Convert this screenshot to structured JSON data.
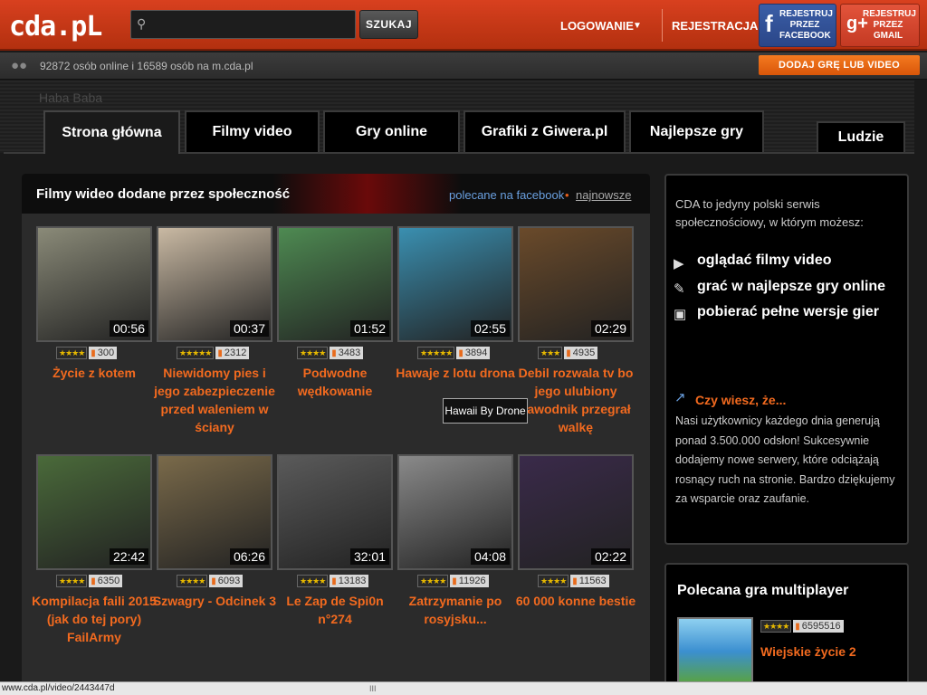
{
  "header": {
    "logo": "cda.pL",
    "search_placeholder": "",
    "search_button": "SZUKAJ",
    "login": "LOGOWANIE",
    "register": "REJESTRACJA",
    "facebook_button": "REJESTRUJ PRZEZ FACEBOOK",
    "gmail_button": "REJESTRUJ PRZEZ GMAIL"
  },
  "infobar": {
    "online_text": "92872 osób online i 16589 osób na m.cda.pl",
    "add_button": "DODAJ GRĘ LUB VIDEO"
  },
  "breadcrumb": "Haba Baba",
  "tabs": [
    {
      "label": "Strona główna",
      "active": true
    },
    {
      "label": "Filmy video"
    },
    {
      "label": "Gry online"
    },
    {
      "label": "Grafiki z Giwera.pl"
    },
    {
      "label": "Najlepsze gry"
    },
    {
      "label": "Ludzie"
    }
  ],
  "videos_panel": {
    "title": "Filmy wideo dodane przez społeczność",
    "link_facebook": "polecane na facebook",
    "separator": "•",
    "link_newest": "najnowsze",
    "videos": [
      {
        "title": "Życie z kotem",
        "duration": "00:56",
        "views": "300",
        "stars": "★★★★",
        "thumb_color": "#8a8a78"
      },
      {
        "title": "Niewidomy pies i jego zabezpieczenie przed waleniem w ściany",
        "duration": "00:37",
        "views": "2312",
        "stars": "★★★★★",
        "thumb_color": "#c9b9a3"
      },
      {
        "title": "Podwodne wędkowanie",
        "duration": "01:52",
        "views": "3483",
        "stars": "★★★★",
        "thumb_color": "#4e8a52"
      },
      {
        "title": "Hawaje z lotu drona",
        "duration": "02:55",
        "views": "3894",
        "stars": "★★★★★",
        "thumb_color": "#3a8fb0"
      },
      {
        "title": "Debil rozwala tv bo jego ulubiony zawodnik przegrał walkę",
        "duration": "02:29",
        "views": "4935",
        "stars": "★★★",
        "thumb_color": "#6a4a2a"
      },
      {
        "title": "Kompilacja faili 2015 (jak do tej pory) FailArmy",
        "duration": "22:42",
        "views": "6350",
        "stars": "★★★★",
        "thumb_color": "#4a6a3a"
      },
      {
        "title": "Szwagry - Odcinek 3",
        "duration": "06:26",
        "views": "6093",
        "stars": "★★★★",
        "thumb_color": "#7a6a4a"
      },
      {
        "title": "Le Zap de Spi0n n°274",
        "duration": "32:01",
        "views": "13183",
        "stars": "★★★★",
        "thumb_color": "#5a5a5a"
      },
      {
        "title": "Zatrzymanie po rosyjsku...",
        "duration": "04:08",
        "views": "11926",
        "stars": "★★★★",
        "thumb_color": "#8a8a8a"
      },
      {
        "title": "60 000 konne bestie",
        "duration": "02:22",
        "views": "11563",
        "stars": "★★★★",
        "thumb_color": "#3a2a4a"
      }
    ],
    "tooltip": "Hawaii By Drone"
  },
  "info_panel": {
    "intro": "CDA to jedyny polski serwis społecznościowy, w którym możesz:",
    "features": [
      "oglądać filmy video",
      "grać w najlepsze gry online",
      "pobierać pełne wersje gier"
    ],
    "did_you_know_title": "Czy wiesz, że...",
    "did_you_know_text": "Nasi użytkownicy każdego dnia generują ponad 3.500.000 odsłon! Sukcesywnie dodajemy nowe serwery, które odciążają rosnący ruch na stronie. Bardzo dziękujemy za wsparcie oraz zaufanie."
  },
  "recommended": {
    "title": "Polecana gra multiplayer",
    "game_name": "Wiejskie życie 2",
    "game_views": "6595516",
    "game_stars": "★★★★"
  },
  "statusbar": {
    "url": "www.cda.pl/video/2443447d",
    "grip": "III"
  }
}
